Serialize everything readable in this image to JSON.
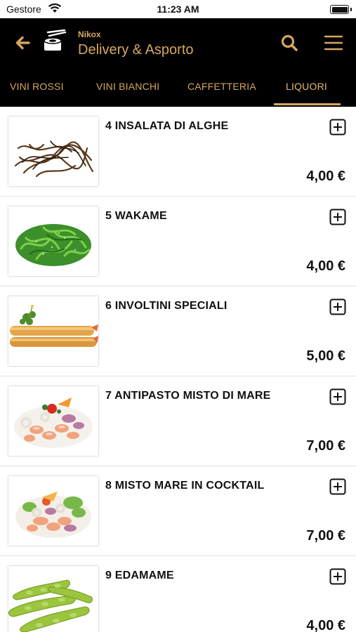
{
  "status_bar": {
    "carrier": "Gestore",
    "time": "11:23 AM"
  },
  "header": {
    "brand_small": "Nikox",
    "title": "Delivery & Asporto"
  },
  "tabs": [
    {
      "label": "VINI ROSSI"
    },
    {
      "label": "VINI BIANCHI"
    },
    {
      "label": "CAFFETTERIA"
    },
    {
      "label": "LIQUORI",
      "active": true
    }
  ],
  "items": [
    {
      "name": "4 INSALATA DI ALGHE",
      "price": "4,00 €",
      "image": "seaweed-salad"
    },
    {
      "name": "5 WAKAME",
      "price": "4,00 €",
      "image": "wakame"
    },
    {
      "name": "6 INVOLTINI SPECIALI",
      "price": "5,00 €",
      "image": "spring-rolls"
    },
    {
      "name": "7 ANTIPASTO MISTO DI MARE",
      "price": "7,00 €",
      "image": "seafood-appetizer"
    },
    {
      "name": "8 MISTO MARE IN COCKTAIL",
      "price": "7,00 €",
      "image": "seafood-cocktail"
    },
    {
      "name": "9 EDAMAME",
      "price": "4,00 €",
      "image": "edamame"
    }
  ],
  "colors": {
    "accent": "#d6a760",
    "header_bg": "#000000"
  }
}
